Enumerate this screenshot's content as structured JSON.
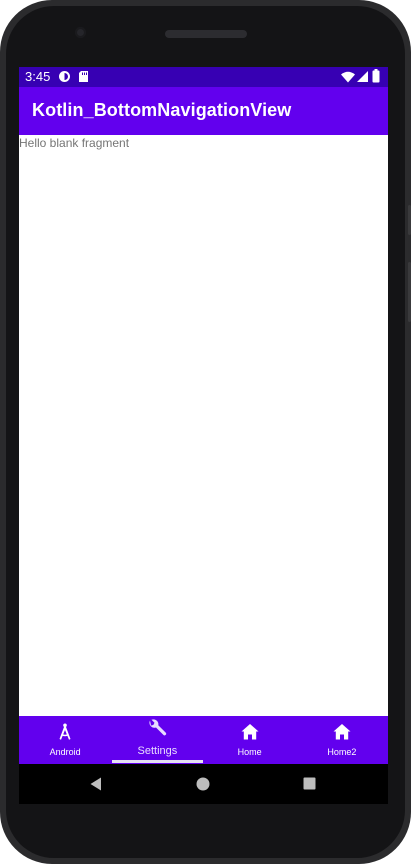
{
  "status_bar": {
    "time": "3:45",
    "icons": [
      "data-saver-icon",
      "sd-card-icon",
      "wifi-icon",
      "signal-icon",
      "battery-icon"
    ]
  },
  "app_bar": {
    "title": "Kotlin_BottomNavigationView"
  },
  "content": {
    "message": "Hello blank fragment"
  },
  "bottom_nav": {
    "selected_index": 1,
    "items": [
      {
        "label": "Android",
        "icon": "compass-icon"
      },
      {
        "label": "Settings",
        "icon": "wrench-icon"
      },
      {
        "label": "Home",
        "icon": "home-icon"
      },
      {
        "label": "Home2",
        "icon": "home-icon"
      }
    ]
  },
  "system_nav": {
    "buttons": [
      "back-icon",
      "home-circle-icon",
      "recents-icon"
    ]
  },
  "colors": {
    "status_bar": "#3700b3",
    "primary": "#6200ee",
    "on_primary": "#ffffff",
    "body_text": "#757575"
  }
}
